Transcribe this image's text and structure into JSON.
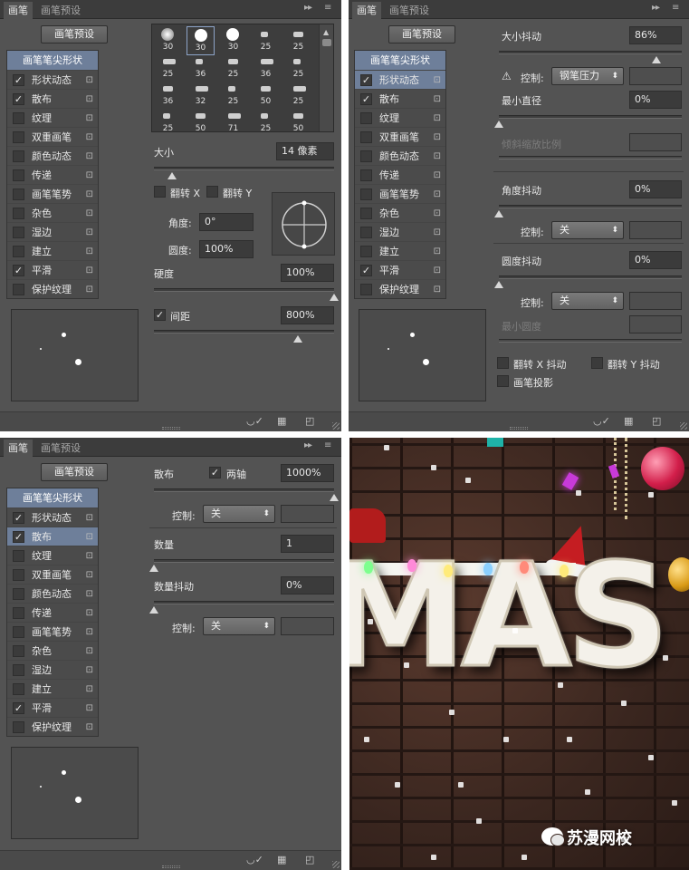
{
  "tabs": {
    "brush": "画笔",
    "presets": "画笔预设",
    "collapse": "▸▸",
    "menu": "≡"
  },
  "preset_button": "画笔预设",
  "list_header": "画笔笔尖形状",
  "list_items": [
    {
      "label": "形状动态"
    },
    {
      "label": "散布"
    },
    {
      "label": "纹理"
    },
    {
      "label": "双重画笔"
    },
    {
      "label": "颜色动态"
    },
    {
      "label": "传递"
    },
    {
      "label": "画笔笔势"
    },
    {
      "label": "杂色"
    },
    {
      "label": "湿边"
    },
    {
      "label": "建立"
    },
    {
      "label": "平滑"
    },
    {
      "label": "保护纹理"
    }
  ],
  "check_mark": "✓",
  "lock_glyph": "🔒",
  "panel1": {
    "checked": [
      true,
      true,
      false,
      false,
      false,
      false,
      false,
      false,
      false,
      false,
      true,
      false
    ],
    "selected_index": -1,
    "tip_sizes": [
      "30",
      "30",
      "30",
      "25",
      "25",
      "25",
      "36",
      "25",
      "36",
      "25",
      "36",
      "32",
      "25",
      "50",
      "25",
      "25",
      "50",
      "71",
      "25",
      "50"
    ],
    "size_label": "大小",
    "size_value": "14 像素",
    "size_level": 0.1,
    "flip_x": "翻转 X",
    "flip_y": "翻转 Y",
    "angle_label": "角度:",
    "angle_value": "0°",
    "roundness_label": "圆度:",
    "roundness_value": "100%",
    "hardness_label": "硬度",
    "hardness_value": "100%",
    "hardness_level": 1.0,
    "spacing_label": "间距",
    "spacing_value": "800%",
    "spacing_level": 0.8
  },
  "panel2": {
    "checked": [
      true,
      true,
      false,
      false,
      false,
      false,
      false,
      false,
      false,
      false,
      true,
      false
    ],
    "selected_index": 0,
    "size_jitter_label": "大小抖动",
    "size_jitter_value": "86%",
    "size_jitter_level": 0.86,
    "warning": "⚠",
    "control_label": "控制:",
    "control_pen_value": "钢笔压力",
    "min_diameter_label": "最小直径",
    "min_diameter_value": "0%",
    "tilt_scale_label": "倾斜缩放比例",
    "angle_jitter_label": "角度抖动",
    "angle_jitter_value": "0%",
    "control_off": "关",
    "roundness_jitter_label": "圆度抖动",
    "roundness_jitter_value": "0%",
    "min_roundness_label": "最小圆度",
    "flip_x_jitter": "翻转 X 抖动",
    "flip_y_jitter": "翻转 Y 抖动",
    "brush_projection": "画笔投影"
  },
  "panel3": {
    "checked": [
      true,
      true,
      false,
      false,
      false,
      false,
      false,
      false,
      false,
      false,
      true,
      false
    ],
    "selected_index": 1,
    "scatter_label": "散布",
    "both_axes": "两轴",
    "scatter_value": "1000%",
    "scatter_level": 1.0,
    "control_label": "控制:",
    "control_off": "关",
    "count_label": "数量",
    "count_value": "1",
    "count_jitter_label": "数量抖动",
    "count_jitter_value": "0%"
  },
  "photo": {
    "text": "MAS",
    "watermark": "苏漫网校"
  },
  "colors": {
    "panel": "#535353",
    "selection": "#6e7f9a",
    "field": "#3b3b3b"
  }
}
